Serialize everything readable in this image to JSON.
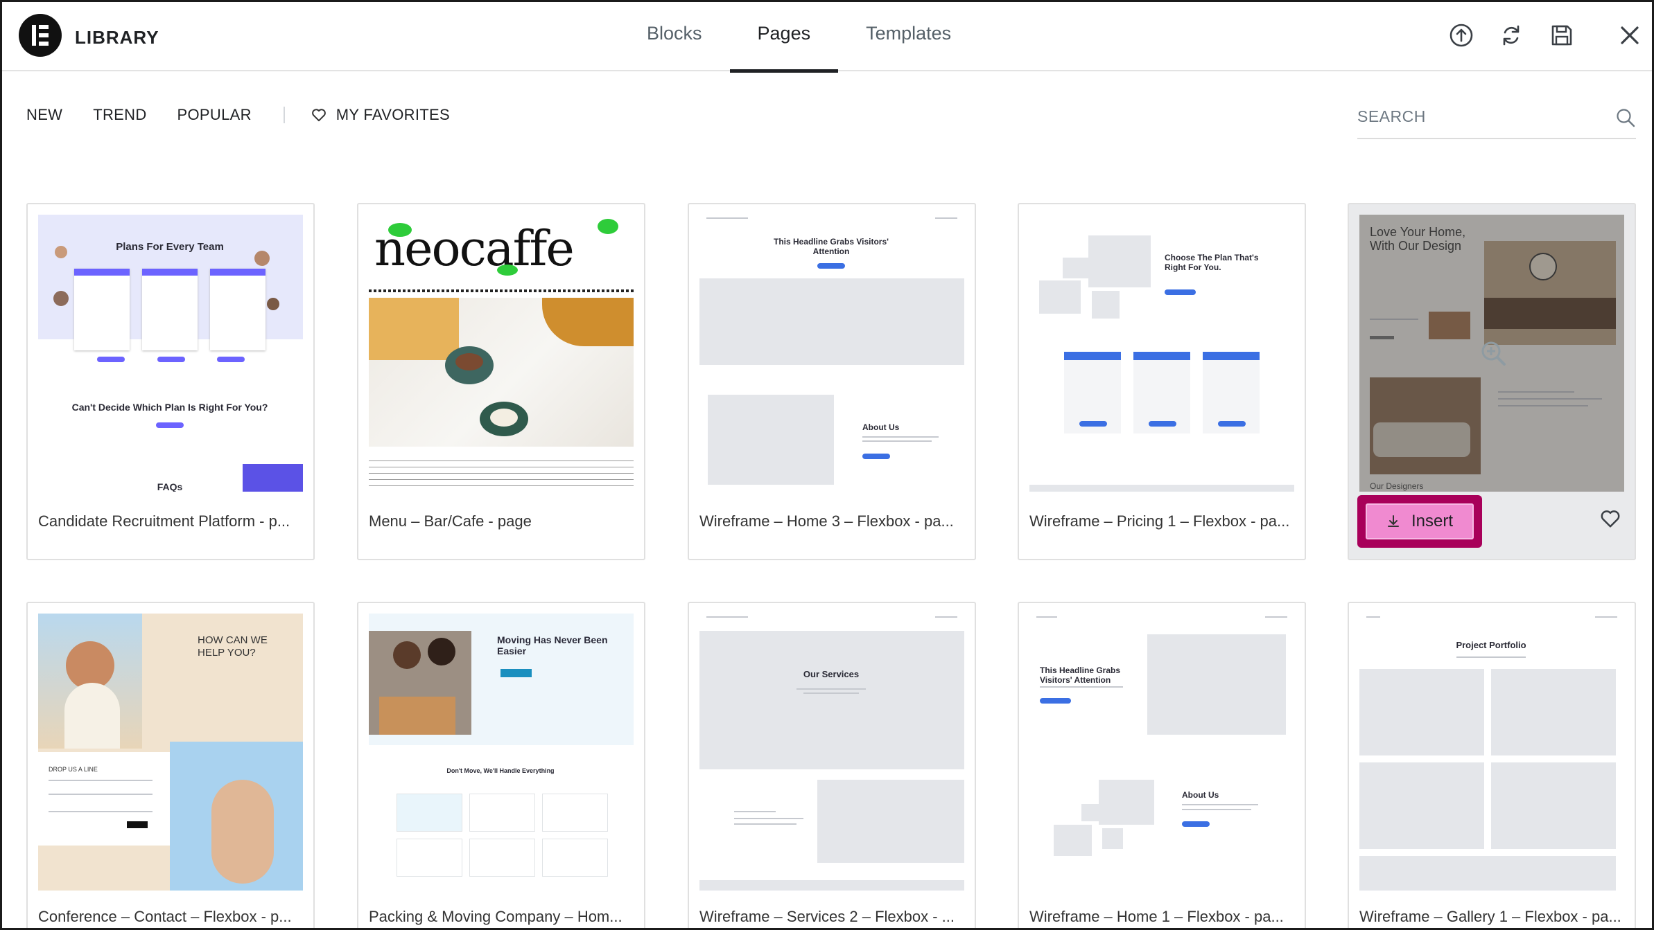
{
  "header": {
    "app_title": "LIBRARY",
    "tabs": [
      {
        "label": "Blocks"
      },
      {
        "label": "Pages"
      },
      {
        "label": "Templates"
      }
    ],
    "icons": [
      "upload-icon",
      "sync-icon",
      "save-icon",
      "close-icon"
    ]
  },
  "filters": {
    "items": [
      "NEW",
      "TREND",
      "POPULAR"
    ],
    "favorites_label": "MY FAVORITES"
  },
  "search": {
    "placeholder": "SEARCH"
  },
  "cards": [
    {
      "title": "Candidate Recruitment Platform - p..."
    },
    {
      "title": "Menu – Bar/Cafe - page"
    },
    {
      "title": "Wireframe – Home 3 – Flexbox - pa..."
    },
    {
      "title": "Wireframe – Pricing 1 – Flexbox - pa..."
    },
    {
      "title": "",
      "insert_label": "Insert"
    },
    {
      "title": "Conference – Contact – Flexbox - p..."
    },
    {
      "title": "Packing & Moving Company – Hom..."
    },
    {
      "title": "Wireframe – Services 2 – Flexbox - ..."
    },
    {
      "title": "Wireframe – Home 1 – Flexbox - pa..."
    },
    {
      "title": "Wireframe – Gallery 1 – Flexbox - pa..."
    }
  ],
  "thumbs": {
    "recruit": {
      "heading": "Plans For Every Team",
      "sub": "Can't Decide Which Plan Is Right For You?",
      "faq": "FAQs"
    },
    "cafe": {
      "brand": "neocaffe"
    },
    "home3": {
      "heading": "This Headline Grabs Visitors' Attention",
      "about": "About Us"
    },
    "pricing1": {
      "heading": "Choose The Plan That's Right For You."
    },
    "interior": {
      "heading": "Love Your Home, With Our Design",
      "footer": "Our Designers"
    },
    "conference": {
      "heading": "HOW CAN WE HELP YOU?",
      "drop": "DROP US A LINE"
    },
    "moving": {
      "heading": "Moving Has Never Been Easier",
      "sub": "Don't Move, We'll Handle Everything"
    },
    "services2": {
      "heading": "Our Services"
    },
    "home1": {
      "heading": "This Headline Grabs Visitors' Attention",
      "about": "About Us"
    },
    "gallery1": {
      "heading": "Project Portfolio"
    }
  },
  "colors": {
    "accent_pink": "#f08ad0",
    "highlight_border": "#a8005a",
    "wire_blue": "#3b6fe3",
    "recruit_purple": "#6c63ff"
  }
}
